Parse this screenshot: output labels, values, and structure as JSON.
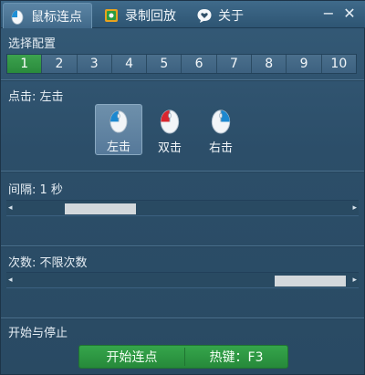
{
  "tabs": [
    {
      "label": "鼠标连点",
      "icon": "mouse-icon"
    },
    {
      "label": "录制回放",
      "icon": "record-icon"
    },
    {
      "label": "关于",
      "icon": "heart-chat-icon"
    }
  ],
  "window_controls": {
    "minimize": "−",
    "close": "✕"
  },
  "config": {
    "label": "选择配置",
    "options": [
      "1",
      "2",
      "3",
      "4",
      "5",
      "6",
      "7",
      "8",
      "9",
      "10"
    ],
    "selected": "1"
  },
  "click": {
    "label": "点击: 左击",
    "options": [
      {
        "label": "左击",
        "icon": "left-click-mouse-icon"
      },
      {
        "label": "双击",
        "icon": "double-click-mouse-icon"
      },
      {
        "label": "右击",
        "icon": "right-click-mouse-icon"
      }
    ],
    "selected": "左击"
  },
  "interval": {
    "label": "间隔: 1 秒",
    "level": 0.18
  },
  "count": {
    "label": "次数: 不限次数",
    "level": 1.0
  },
  "start_stop": {
    "label": "开始与停止",
    "start_label": "开始连点",
    "hotkey_label": "热键：F3"
  },
  "colors": {
    "accent_green": "#2e9a43",
    "panel": "#2f4f68",
    "selected_tab": "#4a7495"
  }
}
